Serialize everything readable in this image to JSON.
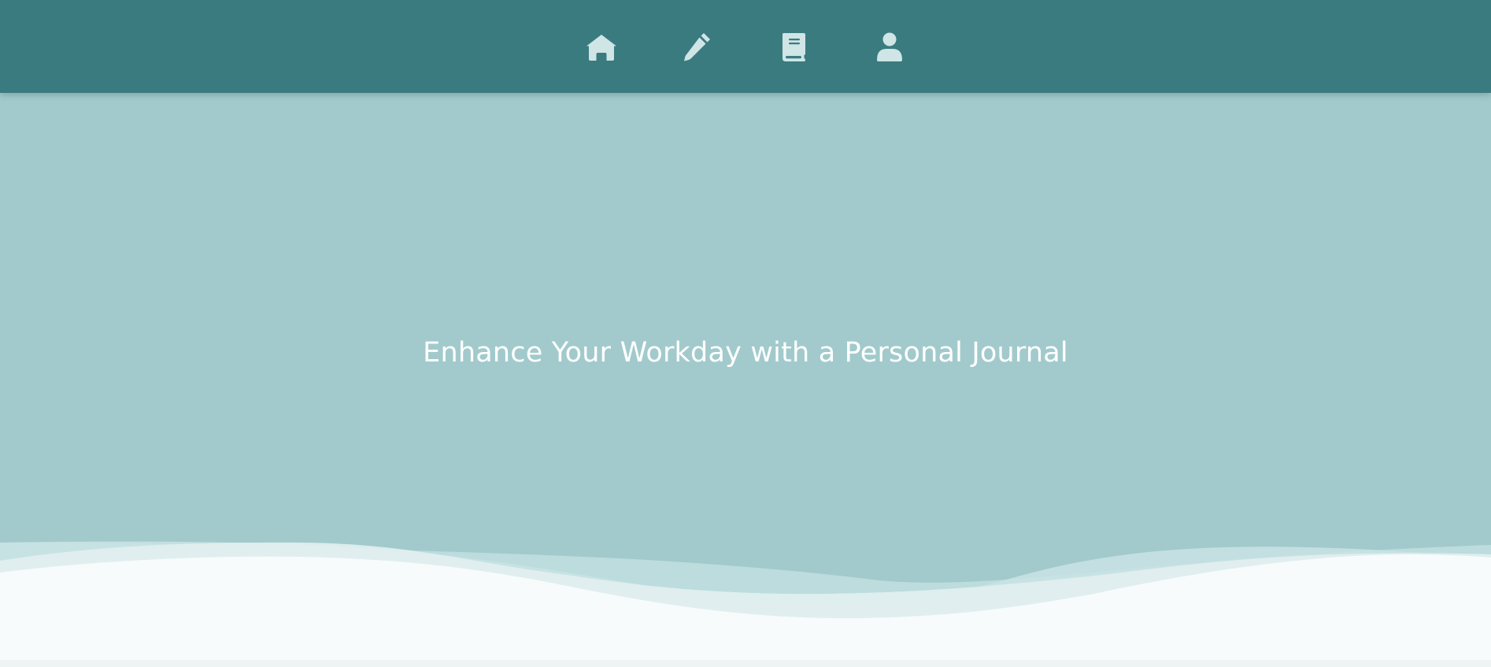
{
  "nav": {
    "items": [
      {
        "icon": "home-icon",
        "label": "Home"
      },
      {
        "icon": "pencil-icon",
        "label": "Write"
      },
      {
        "icon": "journal-book-icon",
        "label": "Journal"
      },
      {
        "icon": "user-icon",
        "label": "Profile"
      }
    ]
  },
  "hero": {
    "title": "Enhance Your Workday with a Personal Journal"
  },
  "colors": {
    "nav_bg": "#3a7b80",
    "hero_bg": "#a2cacc",
    "icon": "#cfe5e6",
    "wave_light": "#f7fbfb"
  }
}
